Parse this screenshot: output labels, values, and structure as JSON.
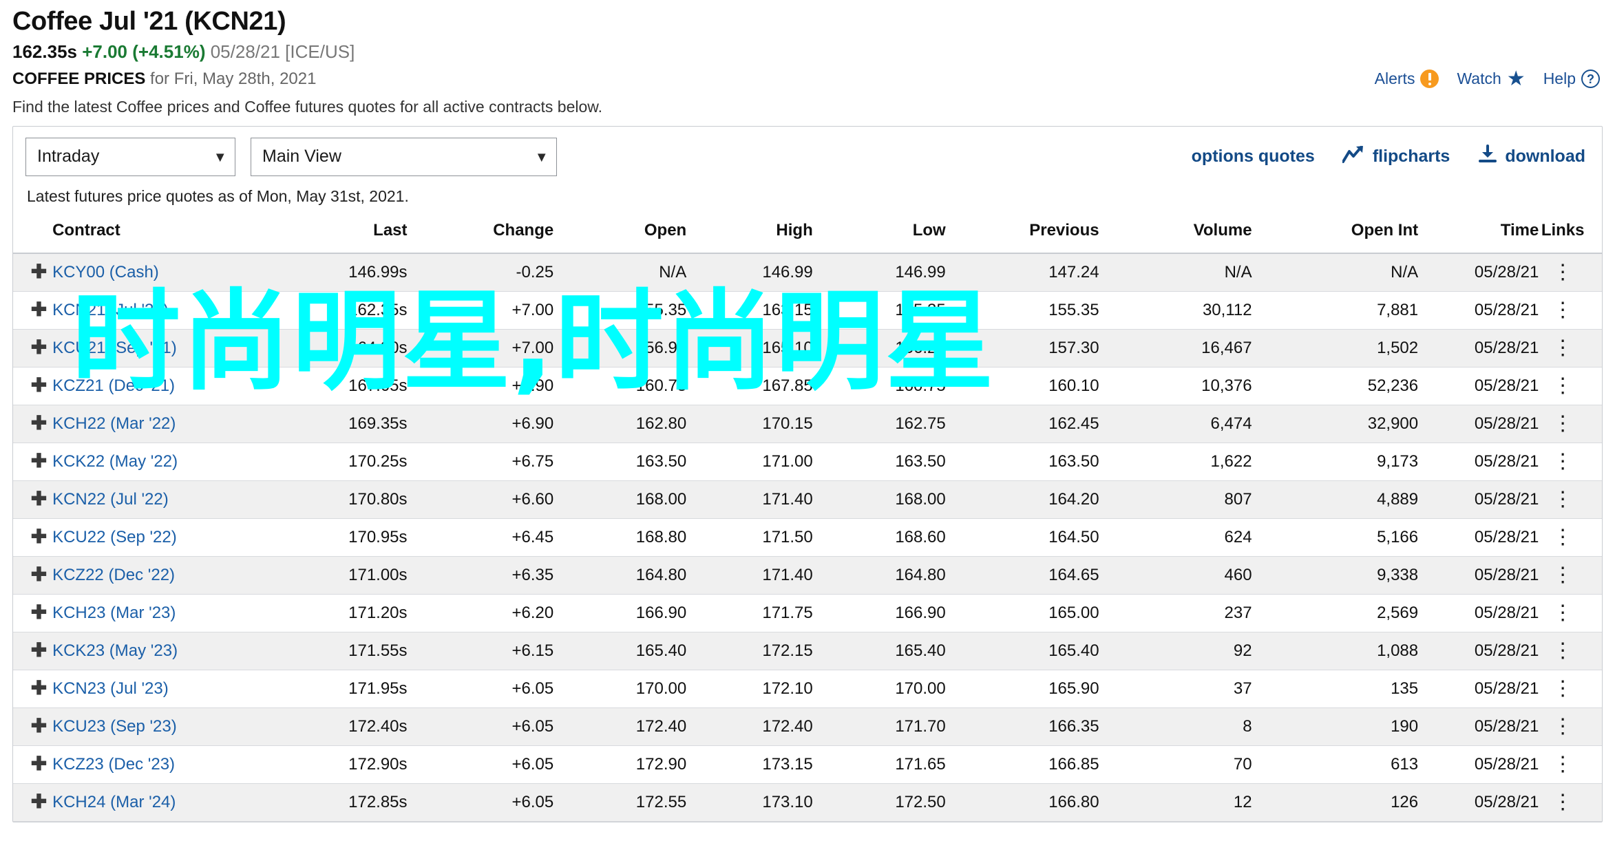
{
  "header": {
    "title": "Coffee Jul '21 (KCN21)",
    "last_price": "162.35s",
    "change": "+7.00",
    "change_pct": "(+4.51%)",
    "quote_date": "05/28/21",
    "exchange": "[ICE/US]",
    "section_label": "COFFEE PRICES",
    "section_rest": " for Fri, May 28th, 2021",
    "description": "Find the latest Coffee prices and Coffee futures quotes for all active contracts below.",
    "links": [
      {
        "label": "Alerts",
        "icon": "alert-icon"
      },
      {
        "label": "Watch",
        "icon": "star-icon"
      },
      {
        "label": "Help",
        "icon": "help-icon"
      }
    ],
    "accent_blue": "#1b4f95",
    "positive_green": "#1a7a33",
    "negative_red": "#c0392b"
  },
  "toolbar": {
    "select_period": "Intraday",
    "select_view": "Main View",
    "options_quotes": "options quotes",
    "flipcharts": "flipcharts",
    "download": "download",
    "latest_note": "Latest futures price quotes as of Mon, May 31st, 2021."
  },
  "table": {
    "columns": [
      "Contract",
      "Last",
      "Change",
      "Open",
      "High",
      "Low",
      "Previous",
      "Volume",
      "Open Int",
      "Time",
      "Links"
    ],
    "rows": [
      {
        "contract": "KCY00 (Cash)",
        "last": "146.99s",
        "change": "-0.25",
        "dir": "neg",
        "open": "N/A",
        "high": "146.99",
        "low": "146.99",
        "previous": "147.24",
        "volume": "N/A",
        "open_int": "N/A",
        "time": "05/28/21"
      },
      {
        "contract": "KCN21 (Jul '21)",
        "last": "162.35s",
        "change": "+7.00",
        "dir": "pos",
        "open": "155.35",
        "high": "163.15",
        "low": "155.35",
        "previous": "155.35",
        "volume": "30,112",
        "open_int": "7,881",
        "time": "05/28/21"
      },
      {
        "contract": "KCU21 (Sep '21)",
        "last": "164.30s",
        "change": "+7.00",
        "dir": "pos",
        "open": "156.95",
        "high": "165.10",
        "low": "156.25",
        "previous": "157.30",
        "volume": "16,467",
        "open_int": "1,502",
        "time": "05/28/21"
      },
      {
        "contract": "KCZ21 (Dec '21)",
        "last": "167.05s",
        "change": "+6.90",
        "dir": "pos",
        "open": "160.75",
        "high": "167.85",
        "low": "160.75",
        "previous": "160.10",
        "volume": "10,376",
        "open_int": "52,236",
        "time": "05/28/21"
      },
      {
        "contract": "KCH22 (Mar '22)",
        "last": "169.35s",
        "change": "+6.90",
        "dir": "pos",
        "open": "162.80",
        "high": "170.15",
        "low": "162.75",
        "previous": "162.45",
        "volume": "6,474",
        "open_int": "32,900",
        "time": "05/28/21"
      },
      {
        "contract": "KCK22 (May '22)",
        "last": "170.25s",
        "change": "+6.75",
        "dir": "pos",
        "open": "163.50",
        "high": "171.00",
        "low": "163.50",
        "previous": "163.50",
        "volume": "1,622",
        "open_int": "9,173",
        "time": "05/28/21"
      },
      {
        "contract": "KCN22 (Jul '22)",
        "last": "170.80s",
        "change": "+6.60",
        "dir": "pos",
        "open": "168.00",
        "high": "171.40",
        "low": "168.00",
        "previous": "164.20",
        "volume": "807",
        "open_int": "4,889",
        "time": "05/28/21"
      },
      {
        "contract": "KCU22 (Sep '22)",
        "last": "170.95s",
        "change": "+6.45",
        "dir": "pos",
        "open": "168.80",
        "high": "171.50",
        "low": "168.60",
        "previous": "164.50",
        "volume": "624",
        "open_int": "5,166",
        "time": "05/28/21"
      },
      {
        "contract": "KCZ22 (Dec '22)",
        "last": "171.00s",
        "change": "+6.35",
        "dir": "pos",
        "open": "164.80",
        "high": "171.40",
        "low": "164.80",
        "previous": "164.65",
        "volume": "460",
        "open_int": "9,338",
        "time": "05/28/21"
      },
      {
        "contract": "KCH23 (Mar '23)",
        "last": "171.20s",
        "change": "+6.20",
        "dir": "pos",
        "open": "166.90",
        "high": "171.75",
        "low": "166.90",
        "previous": "165.00",
        "volume": "237",
        "open_int": "2,569",
        "time": "05/28/21"
      },
      {
        "contract": "KCK23 (May '23)",
        "last": "171.55s",
        "change": "+6.15",
        "dir": "pos",
        "open": "165.40",
        "high": "172.15",
        "low": "165.40",
        "previous": "165.40",
        "volume": "92",
        "open_int": "1,088",
        "time": "05/28/21"
      },
      {
        "contract": "KCN23 (Jul '23)",
        "last": "171.95s",
        "change": "+6.05",
        "dir": "pos",
        "open": "170.00",
        "high": "172.10",
        "low": "170.00",
        "previous": "165.90",
        "volume": "37",
        "open_int": "135",
        "time": "05/28/21"
      },
      {
        "contract": "KCU23 (Sep '23)",
        "last": "172.40s",
        "change": "+6.05",
        "dir": "pos",
        "open": "172.40",
        "high": "172.40",
        "low": "171.70",
        "previous": "166.35",
        "volume": "8",
        "open_int": "190",
        "time": "05/28/21"
      },
      {
        "contract": "KCZ23 (Dec '23)",
        "last": "172.90s",
        "change": "+6.05",
        "dir": "pos",
        "open": "172.90",
        "high": "173.15",
        "low": "171.65",
        "previous": "166.85",
        "volume": "70",
        "open_int": "613",
        "time": "05/28/21"
      },
      {
        "contract": "KCH24 (Mar '24)",
        "last": "172.85s",
        "change": "+6.05",
        "dir": "pos",
        "open": "172.55",
        "high": "173.10",
        "low": "172.50",
        "previous": "166.80",
        "volume": "12",
        "open_int": "126",
        "time": "05/28/21"
      }
    ]
  },
  "watermark": {
    "text": "时尚明星,时尚明星",
    "color": "#00ffff"
  }
}
